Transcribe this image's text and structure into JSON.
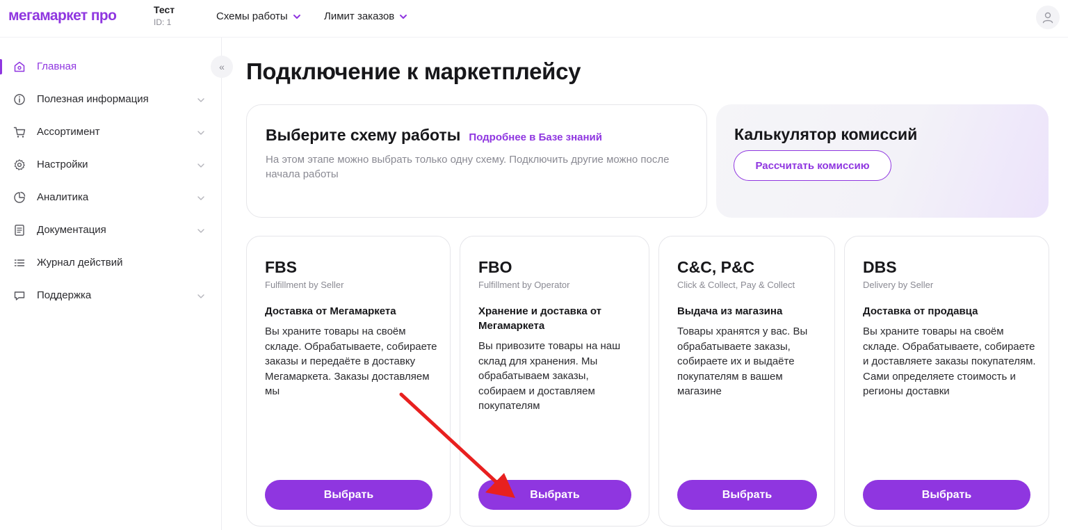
{
  "header": {
    "logo": "мегамаркет про",
    "account_name": "Тест",
    "account_id": "ID: 1",
    "nav": [
      {
        "label": "Схемы работы"
      },
      {
        "label": "Лимит заказов"
      }
    ]
  },
  "sidebar": {
    "items": [
      {
        "label": "Главная",
        "icon": "home-icon",
        "active": true,
        "expandable": false
      },
      {
        "label": "Полезная информация",
        "icon": "info-icon",
        "active": false,
        "expandable": true
      },
      {
        "label": "Ассортимент",
        "icon": "cart-icon",
        "active": false,
        "expandable": true
      },
      {
        "label": "Настройки",
        "icon": "gear-icon",
        "active": false,
        "expandable": true
      },
      {
        "label": "Аналитика",
        "icon": "pie-chart-icon",
        "active": false,
        "expandable": true
      },
      {
        "label": "Документация",
        "icon": "document-icon",
        "active": false,
        "expandable": true
      },
      {
        "label": "Журнал действий",
        "icon": "list-icon",
        "active": false,
        "expandable": false
      },
      {
        "label": "Поддержка",
        "icon": "chat-icon",
        "active": false,
        "expandable": true
      }
    ],
    "collapse_label": "«"
  },
  "main": {
    "title": "Подключение к маркетплейсу",
    "scheme": {
      "heading": "Выберите схему работы",
      "link": "Подробнее в Базе знаний",
      "description": "На этом этапе можно выбрать только одну схему. Подключить другие можно после начала работы"
    },
    "calculator": {
      "title": "Калькулятор комиссий",
      "button": "Рассчитать комиссию"
    },
    "cards": [
      {
        "title": "FBS",
        "subtitle": "Fulfillment by Seller",
        "heading": "Доставка от Мегамаркета",
        "text": "Вы храните товары на своём складе. Обрабатываете, собираете заказы и передаёте в доставку Мегамаркета. Заказы доставляем мы",
        "button": "Выбрать"
      },
      {
        "title": "FBO",
        "subtitle": "Fulfillment by Operator",
        "heading": "Хранение и доставка от Мегамаркета",
        "text": "Вы привозите товары на наш склад для хранения. Мы обрабатываем заказы, собираем и доставляем покупателям",
        "button": "Выбрать"
      },
      {
        "title": "C&C, P&C",
        "subtitle": "Click & Collect, Pay & Collect",
        "heading": "Выдача из магазина",
        "text": "Товары хранятся у вас. Вы обрабатываете заказы, собираете их и выдаёте покупателям в вашем магазине",
        "button": "Выбрать"
      },
      {
        "title": "DBS",
        "subtitle": "Delivery by Seller",
        "heading": "Доставка от продавца",
        "text": "Вы храните товары на своём складе. Обрабатываете, собираете и доставляете заказы покупателям. Сами определяете стоимость и регионы доставки",
        "button": "Выбрать"
      }
    ]
  },
  "colors": {
    "brand": "#8f36e0",
    "annotation_arrow": "#e8201f",
    "text_primary": "#17171a",
    "text_secondary": "#8a8a93"
  }
}
